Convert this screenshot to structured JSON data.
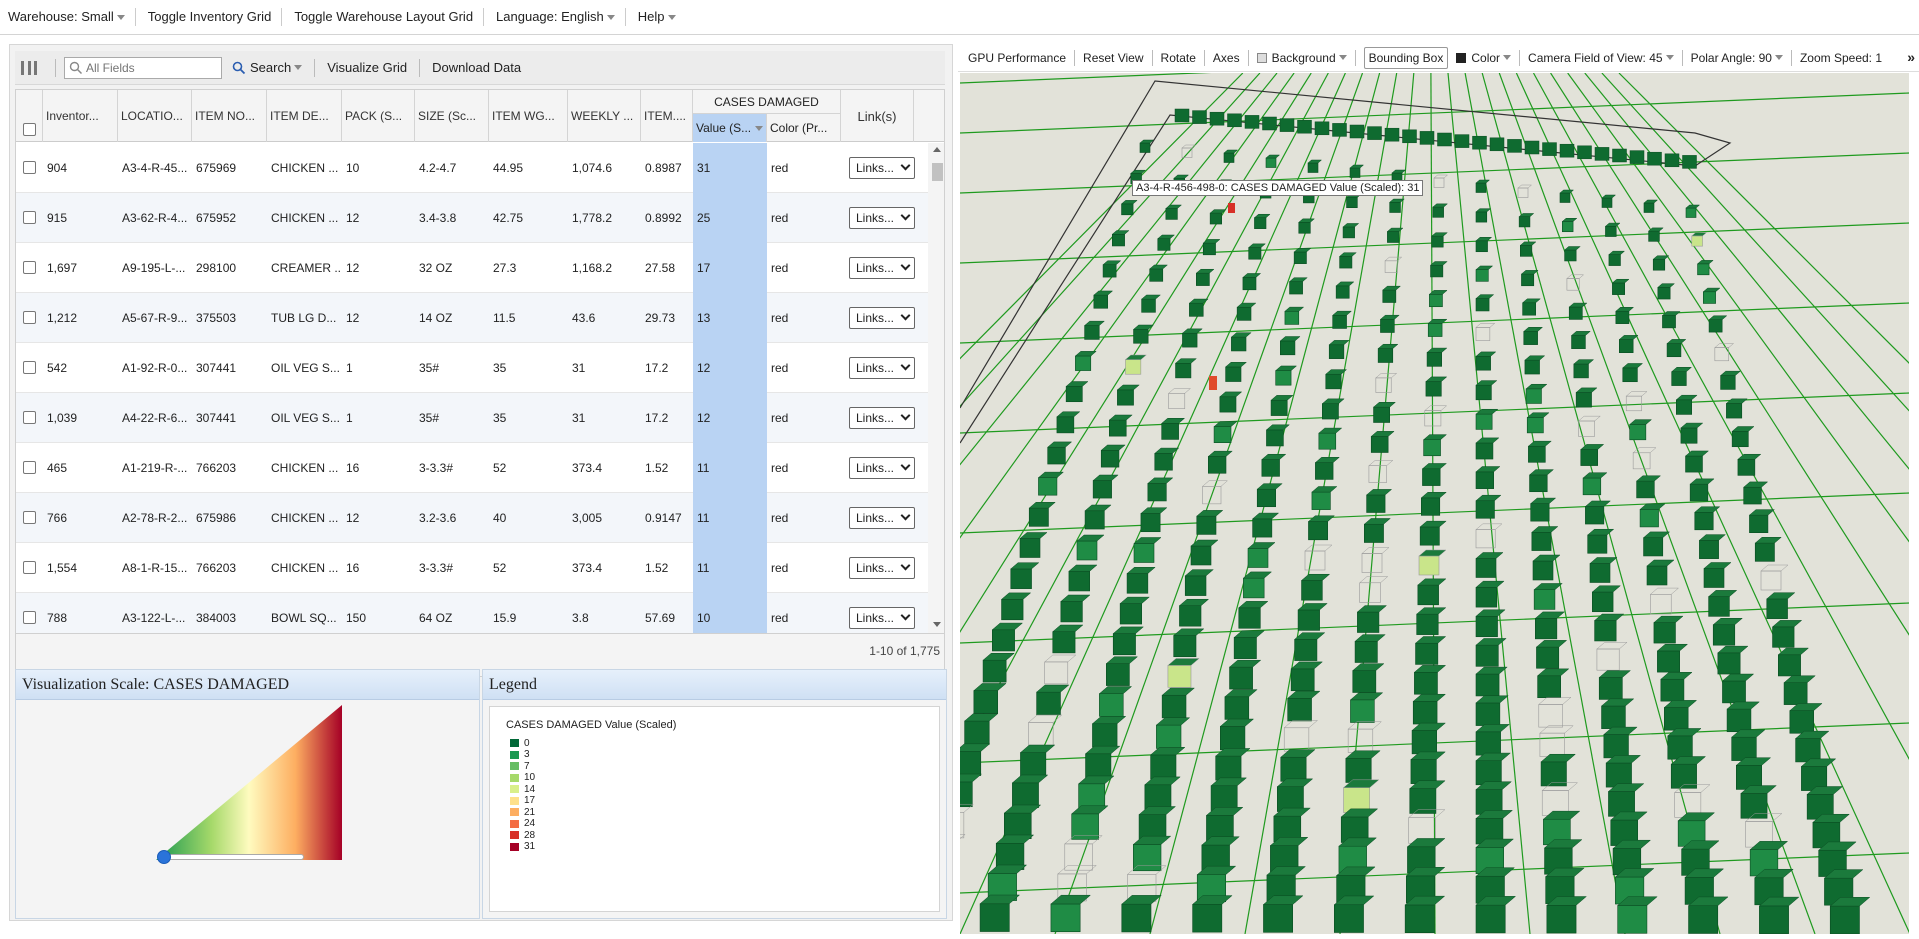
{
  "menu": {
    "warehouse": "Warehouse: Small",
    "toggle_inventory": "Toggle Inventory Grid",
    "toggle_layout": "Toggle Warehouse Layout Grid",
    "language": "Language: English",
    "help": "Help"
  },
  "grid_toolbar": {
    "search_placeholder": "All Fields",
    "search": "Search",
    "visualize": "Visualize Grid",
    "download": "Download Data"
  },
  "grid": {
    "columns": [
      "Inventor...",
      "LOCATIO...",
      "ITEM NO...",
      "ITEM DE...",
      "PACK (S...",
      "SIZE (Sc...",
      "ITEM WG...",
      "WEEKLY ...",
      "ITEM...."
    ],
    "group_header": "CASES DAMAGED",
    "group_sub": [
      "Value (S...",
      "Color (Pr..."
    ],
    "links_header": "Link(s)",
    "link_label": "Links...",
    "rows": [
      [
        "904",
        "A3-4-R-45...",
        "675969",
        "CHICKEN ...",
        "10",
        "4.2-4.7",
        "44.95",
        "1,074.6",
        "0.8987",
        "31",
        "red"
      ],
      [
        "915",
        "A3-62-R-4...",
        "675952",
        "CHICKEN ...",
        "12",
        "3.4-3.8",
        "42.75",
        "1,778.2",
        "0.8992",
        "25",
        "red"
      ],
      [
        "1,697",
        "A9-195-L-...",
        "298100",
        "CREAMER ...",
        "12",
        "32 OZ",
        "27.3",
        "1,168.2",
        "27.58",
        "17",
        "red"
      ],
      [
        "1,212",
        "A5-67-R-9...",
        "375503",
        "TUB LG D...",
        "12",
        "14 OZ",
        "11.5",
        "43.6",
        "29.73",
        "13",
        "red"
      ],
      [
        "542",
        "A1-92-R-0...",
        "307441",
        "OIL VEG S...",
        "1",
        "35#",
        "35",
        "31",
        "17.2",
        "12",
        "red"
      ],
      [
        "1,039",
        "A4-22-R-6...",
        "307441",
        "OIL VEG S...",
        "1",
        "35#",
        "35",
        "31",
        "17.2",
        "12",
        "red"
      ],
      [
        "465",
        "A1-219-R-...",
        "766203",
        "CHICKEN ...",
        "16",
        "3-3.3#",
        "52",
        "373.4",
        "1.52",
        "11",
        "red"
      ],
      [
        "766",
        "A2-78-R-2...",
        "675986",
        "CHICKEN ...",
        "12",
        "3.2-3.6",
        "40",
        "3,005",
        "0.9147",
        "11",
        "red"
      ],
      [
        "1,554",
        "A8-1-R-15...",
        "766203",
        "CHICKEN ...",
        "16",
        "3-3.3#",
        "52",
        "373.4",
        "1.52",
        "11",
        "red"
      ],
      [
        "788",
        "A3-122-L-...",
        "384003",
        "BOWL SQ...",
        "150",
        "64 OZ",
        "15.9",
        "3.8",
        "57.69",
        "10",
        "red"
      ]
    ],
    "pagination": "1-10 of 1,775"
  },
  "viz_scale": {
    "title": "Visualization Scale: CASES DAMAGED",
    "slider_value": 0
  },
  "legend": {
    "title": "Legend",
    "subtitle": "CASES DAMAGED Value (Scaled)",
    "items": [
      {
        "label": "0",
        "color": "#006837"
      },
      {
        "label": "3",
        "color": "#1a9850"
      },
      {
        "label": "7",
        "color": "#66bd63"
      },
      {
        "label": "10",
        "color": "#a6d96a"
      },
      {
        "label": "14",
        "color": "#d9ef8b"
      },
      {
        "label": "17",
        "color": "#fee08b"
      },
      {
        "label": "21",
        "color": "#fdae61"
      },
      {
        "label": "24",
        "color": "#f46d43"
      },
      {
        "label": "28",
        "color": "#d73027"
      },
      {
        "label": "31",
        "color": "#a50026"
      }
    ]
  },
  "view_toolbar": {
    "gpu": "GPU Performance",
    "reset": "Reset View",
    "rotate": "Rotate",
    "axes": "Axes",
    "background": "Background",
    "bounding_box": "Bounding Box",
    "color": "Color",
    "fov": "Camera Field of View: 45",
    "polar": "Polar Angle: 90",
    "zoom": "Zoom Speed: 1"
  },
  "scene": {
    "tooltip": "A3-4-R-456-498-0: CASES DAMAGED Value (Scaled): 31",
    "floor_color": "#e2e2d9",
    "grid_line_color": "#1f9a1f",
    "box_dark": "#0f6b30",
    "box_light": "#1f8c45"
  }
}
